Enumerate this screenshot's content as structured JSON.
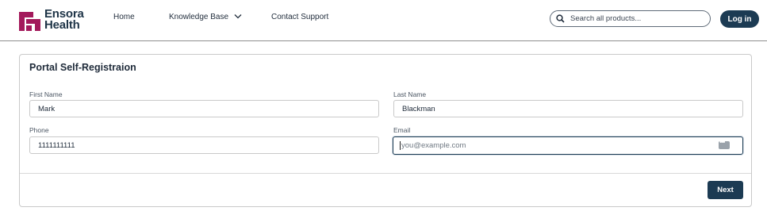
{
  "header": {
    "brand": {
      "line1": "Ensora",
      "line2": "Health",
      "color": "#a3195b"
    },
    "nav": [
      {
        "label": "Home"
      },
      {
        "label": "Knowledge Base",
        "has_dropdown": true
      },
      {
        "label": "Contact Support"
      }
    ],
    "search": {
      "placeholder": "Search all products...",
      "value": ""
    },
    "login_label": "Log in"
  },
  "form": {
    "title": "Portal Self-Registraion",
    "fields": {
      "first_name": {
        "label": "First Name",
        "value": "Mark"
      },
      "last_name": {
        "label": "Last Name",
        "value": "Blackman"
      },
      "phone": {
        "label": "Phone",
        "value": "1111111111"
      },
      "email": {
        "label": "Email",
        "value": "",
        "placeholder": "you@example.com",
        "focused": true
      }
    },
    "next_label": "Next"
  },
  "colors": {
    "primary": "#1c3b53",
    "brand": "#a3195b",
    "border": "#c9c9c9"
  }
}
